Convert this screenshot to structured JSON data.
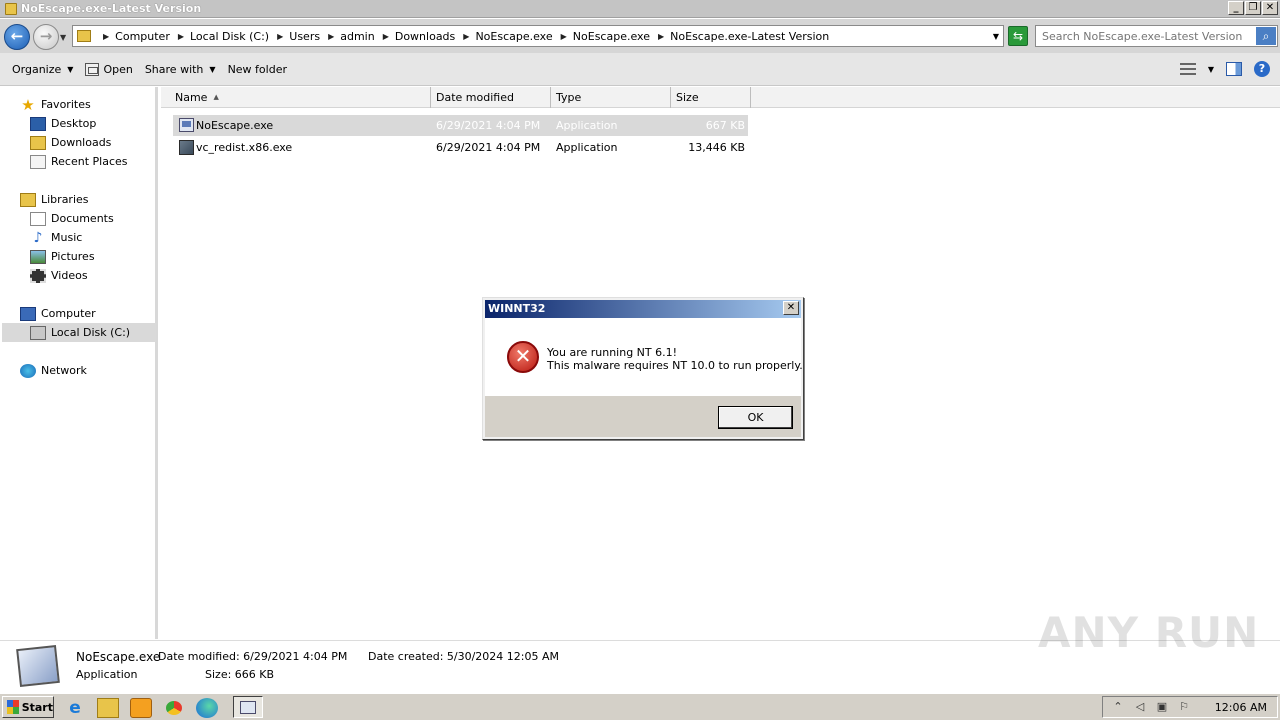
{
  "window": {
    "title": "NoEscape.exe-Latest Version"
  },
  "address": {
    "crumbs": [
      "Computer",
      "Local Disk (C:)",
      "Users",
      "admin",
      "Downloads",
      "NoEscape.exe",
      "NoEscape.exe",
      "NoEscape.exe-Latest Version"
    ]
  },
  "search": {
    "placeholder": "Search NoEscape.exe-Latest Version"
  },
  "toolbar": {
    "organize": "Organize",
    "open": "Open",
    "share_with": "Share with",
    "new_folder": "New folder"
  },
  "nav": {
    "favorites": "Favorites",
    "desktop": "Desktop",
    "downloads": "Downloads",
    "recent_places": "Recent Places",
    "libraries": "Libraries",
    "documents": "Documents",
    "music": "Music",
    "pictures": "Pictures",
    "videos": "Videos",
    "computer": "Computer",
    "local_disk": "Local Disk (C:)",
    "network": "Network"
  },
  "columns": {
    "name": "Name",
    "date_modified": "Date modified",
    "type": "Type",
    "size": "Size"
  },
  "files": [
    {
      "name": "NoEscape.exe",
      "date": "6/29/2021 4:04 PM",
      "type": "Application",
      "size": "667 KB"
    },
    {
      "name": "vc_redist.x86.exe",
      "date": "6/29/2021 4:04 PM",
      "type": "Application",
      "size": "13,446 KB"
    }
  ],
  "details": {
    "name": "NoEscape.exe",
    "type": "Application",
    "date_modified": "Date modified: 6/29/2021 4:04 PM",
    "size": "Size: 666 KB",
    "date_created": "Date created: 5/30/2024 12:05 AM"
  },
  "dialog": {
    "title": "WINNT32",
    "line1": "You are running NT 6.1!",
    "line2": "This malware requires NT 10.0 to run properly.",
    "ok": "OK",
    "close": "✕"
  },
  "taskbar": {
    "start": "Start",
    "clock": "12:06 AM"
  },
  "watermark": "ANY RUN",
  "colors": {
    "dialog_title_start": "#0a246a",
    "dialog_title_end": "#a6caf0",
    "selection": "#d9d9d9"
  }
}
